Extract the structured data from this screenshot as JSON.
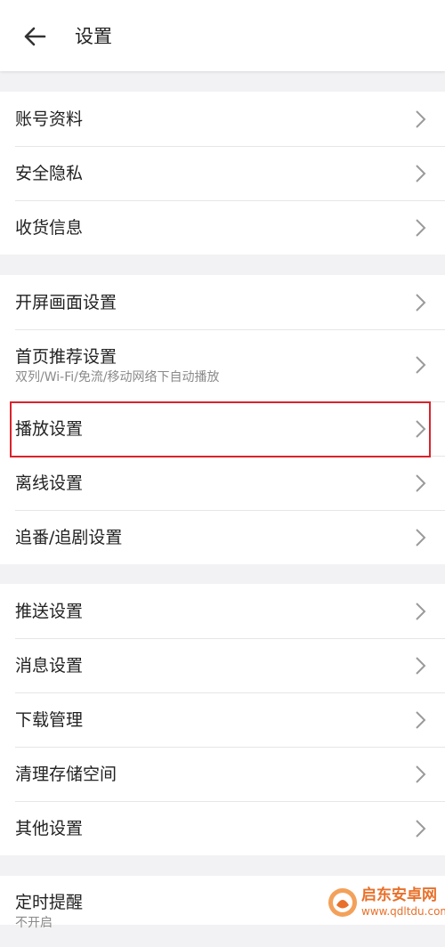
{
  "header": {
    "title": "设置"
  },
  "groups": [
    {
      "items": [
        {
          "label": "账号资料"
        },
        {
          "label": "安全隐私"
        },
        {
          "label": "收货信息"
        }
      ]
    },
    {
      "items": [
        {
          "label": "开屏画面设置"
        },
        {
          "label": "首页推荐设置",
          "subtitle": "双列/Wi-Fi/免流/移动网络下自动播放"
        },
        {
          "label": "播放设置",
          "highlighted": true
        },
        {
          "label": "离线设置"
        },
        {
          "label": "追番/追剧设置"
        }
      ]
    },
    {
      "items": [
        {
          "label": "推送设置"
        },
        {
          "label": "消息设置"
        },
        {
          "label": "下载管理"
        },
        {
          "label": "清理存储空间"
        },
        {
          "label": "其他设置"
        }
      ]
    },
    {
      "items": [
        {
          "label": "定时提醒",
          "subtitle": "不开启"
        }
      ]
    }
  ],
  "watermark": {
    "name": "启东安卓网",
    "url": "www.qdltdu.com"
  },
  "colors": {
    "highlight": "#d9232b",
    "watermark": "#e8702a"
  }
}
